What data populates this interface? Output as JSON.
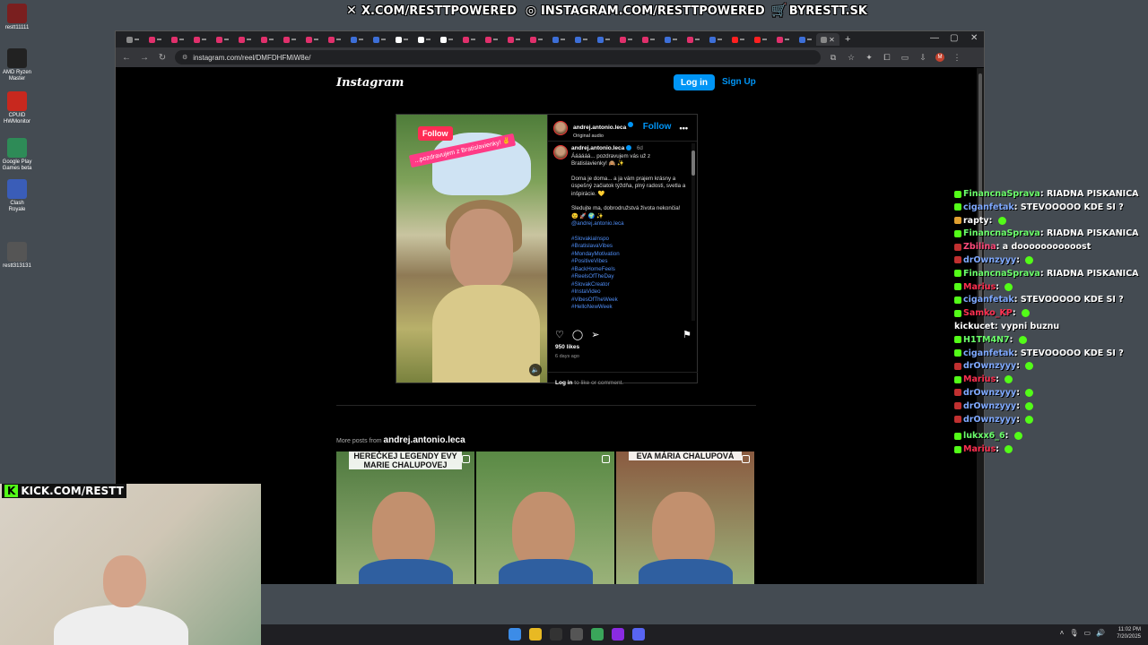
{
  "banner": {
    "items": [
      {
        "icon": "x-logo-icon",
        "text": "X.COM/RESTTPOWERED"
      },
      {
        "icon": "instagram-logo-icon",
        "text": "INSTAGRAM.COM/RESTTPOWERED"
      },
      {
        "icon": "shopping-cart-icon",
        "text": "BYRESTT.SK"
      }
    ]
  },
  "desktop": {
    "icons": [
      {
        "label": "restt11111",
        "color": "#7a1f1f"
      },
      {
        "label": "AMD Ryzen Master",
        "color": "#222222"
      },
      {
        "label": "CPUID HWMonitor",
        "color": "#c8281e"
      },
      {
        "label": "Google Play Games beta",
        "color": "#2e8b57"
      },
      {
        "label": "Clash Royale",
        "color": "#3a5db8"
      },
      {
        "label": "restt313131",
        "color": "#555555"
      }
    ]
  },
  "browser": {
    "url": "instagram.com/reel/DMFDHFMiW8e/"
  },
  "instagram": {
    "logo": "Instagram",
    "login_label": "Log in",
    "signup_label": "Sign Up",
    "post": {
      "username": "andrej.antonio.leca",
      "audio": "Original audio",
      "follow_label": "Follow",
      "follow_sticker": "Follow",
      "media_caption": "...pozdravujem z Bratislavienky! ✌",
      "age_short": "6d",
      "caption_paragraphs": [
        "Áááááá... pozdravujem vás už z Bratislavienky! 🙈 ✨",
        "Doma je doma... a ja vám prajem krásny a úspešný začiatok týždňa, plný radosti, svetla a inšpirácie. 💛",
        "Sledujte ma, dobrodružstvá života nekončia! 😉 🚀 🌍 ✨"
      ],
      "mention": "@andrej.antonio.leca",
      "hashtags": [
        "#SlovakiaInspo",
        "#BratislavaVibes",
        "#MondayMotivation",
        "#PositiveVibes",
        "#BackHomeFeels",
        "#ReelsOfTheDay",
        "#SlovakCreator",
        "#InstaVideo",
        "#VibesOfTheWeek",
        "#HelloNewWeek"
      ],
      "likes": "950 likes",
      "age_long": "6 days ago",
      "login_prompt_link": "Log in",
      "login_prompt_rest": " to like or comment."
    },
    "more_posts_prefix": "More posts from",
    "more_posts_user": "andrej.antonio.leca",
    "thumbnails": [
      {
        "title": "HEREČKEJ LEGENDY EVY MARIE CHALUPOVEJ",
        "bg": "#4f7a3f"
      },
      {
        "title": "",
        "bg": "#5a8a45"
      },
      {
        "title": "EVA MÁRIA CHALUPOVÁ",
        "bg": "#8a5a40"
      }
    ]
  },
  "chat": [
    {
      "user": "FinancnaSprava",
      "color": "#6cff6c",
      "text": "RIADNA PISKANICA",
      "badge": "#53fc18"
    },
    {
      "user": "ciganfetak",
      "color": "#7fa9ff",
      "text": "STEVOOOOO KDE SI ?",
      "badge": "#53fc18"
    },
    {
      "user": "rapty",
      "color": "#ffffff",
      "text": "",
      "badge": "#e0a030",
      "emote": true
    },
    {
      "user": "FinancnaSprava",
      "color": "#6cff6c",
      "text": "RIADNA PISKANICA",
      "badge": "#53fc18"
    },
    {
      "user": "Zbilina",
      "color": "#ff4a7a",
      "text": "a dooooooooooost",
      "badge": "#c03030"
    },
    {
      "user": "drOwnzyyy",
      "color": "#7fa9ff",
      "text": "",
      "badge": "#c03030",
      "emote": true
    },
    {
      "user": "FinancnaSprava",
      "color": "#6cff6c",
      "text": "RIADNA PISKANICA",
      "badge": "#53fc18"
    },
    {
      "user": "Marius",
      "color": "#ff3050",
      "text": "",
      "badge": "#53fc18",
      "emote": true
    },
    {
      "user": "ciganfetak",
      "color": "#7fa9ff",
      "text": "STEVOOOOO KDE SI ?",
      "badge": "#53fc18"
    },
    {
      "user": "Samko_KP",
      "color": "#ff3050",
      "text": "",
      "badge": "#53fc18",
      "emote": true
    },
    {
      "user": "kickucet",
      "color": "#ffffff",
      "text": "vypni buznu",
      "badge": ""
    },
    {
      "user": "H1TM4N7",
      "color": "#6cff6c",
      "text": "",
      "badge": "#53fc18",
      "emote": true
    },
    {
      "user": "ciganfetak",
      "color": "#7fa9ff",
      "text": "STEVOOOOO KDE SI ?",
      "badge": "#53fc18"
    },
    {
      "user": "drOwnzyyy",
      "color": "#7fa9ff",
      "text": "",
      "badge": "#c03030",
      "emote": true
    },
    {
      "user": "Marius",
      "color": "#ff3050",
      "text": "",
      "badge": "#53fc18",
      "emote": true
    },
    {
      "user": "drOwnzyyy",
      "color": "#7fa9ff",
      "text": "",
      "badge": "#c03030",
      "emote": true
    },
    {
      "user": "drOwnzyyy",
      "color": "#7fa9ff",
      "text": "",
      "badge": "#c03030",
      "emote": true
    },
    {
      "user": "drOwnzyyy",
      "color": "#7fa9ff",
      "text": "",
      "badge": "#c03030",
      "emote": true
    },
    {
      "user": "",
      "color": "#ffffff",
      "text": "",
      "badge": ""
    },
    {
      "user": "lukxx6_6",
      "color": "#6cff6c",
      "text": "",
      "badge": "#53fc18",
      "emote": true
    },
    {
      "user": "Marius",
      "color": "#ff3050",
      "text": "",
      "badge": "#53fc18",
      "emote": true
    }
  ],
  "webcam": {
    "kick_label": "KICK.COM/RESTT",
    "kick_logo": "K"
  },
  "taskbar": {
    "apps": [
      {
        "name": "start",
        "color": "#3c8ce7"
      },
      {
        "name": "file-explorer",
        "color": "#e8b923"
      },
      {
        "name": "terminal",
        "color": "#333333"
      },
      {
        "name": "obs",
        "color": "#555555"
      },
      {
        "name": "chrome",
        "color": "#3aa55a"
      },
      {
        "name": "app-purple",
        "color": "#8a2be2"
      },
      {
        "name": "discord",
        "color": "#5865f2"
      }
    ],
    "time": "11:02 PM",
    "date": "7/20/2025"
  },
  "colors": {
    "accent": "#0095f6",
    "kick_green": "#53fc18"
  }
}
